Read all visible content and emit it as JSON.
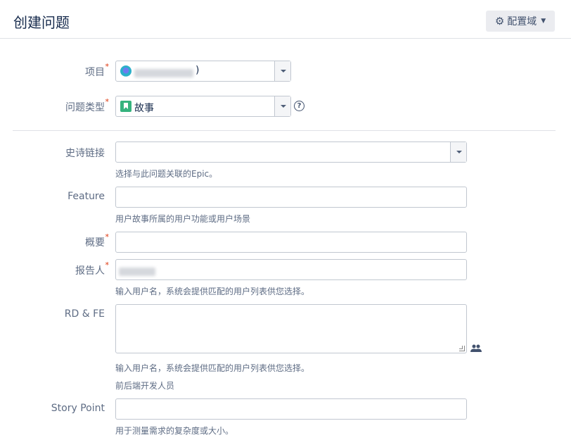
{
  "header": {
    "title": "创建问题",
    "config_label": "配置域"
  },
  "fields": {
    "project": {
      "label": "项目",
      "required": "*",
      "value_suffix": ")"
    },
    "issue_type": {
      "label": "问题类型",
      "required": "*",
      "value": "故事"
    },
    "epic_link": {
      "label": "史诗链接",
      "help": "选择与此问题关联的Epic。"
    },
    "feature": {
      "label": "Feature",
      "help": "用户故事所属的用户功能或用户场景"
    },
    "summary": {
      "label": "概要",
      "required": "*"
    },
    "reporter": {
      "label": "报告人",
      "required": "*",
      "help": "输入用户名，系统会提供匹配的用户列表供您选择。"
    },
    "rd_fe": {
      "label": "RD & FE",
      "help": "输入用户名，系统会提供匹配的用户列表供您选择。",
      "help2": "前后端开发人员"
    },
    "story_point": {
      "label": "Story Point",
      "help": "用于测量需求的复杂度或大小。"
    }
  },
  "colors": {
    "required": "#de350b",
    "story_icon": "#36b37e"
  }
}
